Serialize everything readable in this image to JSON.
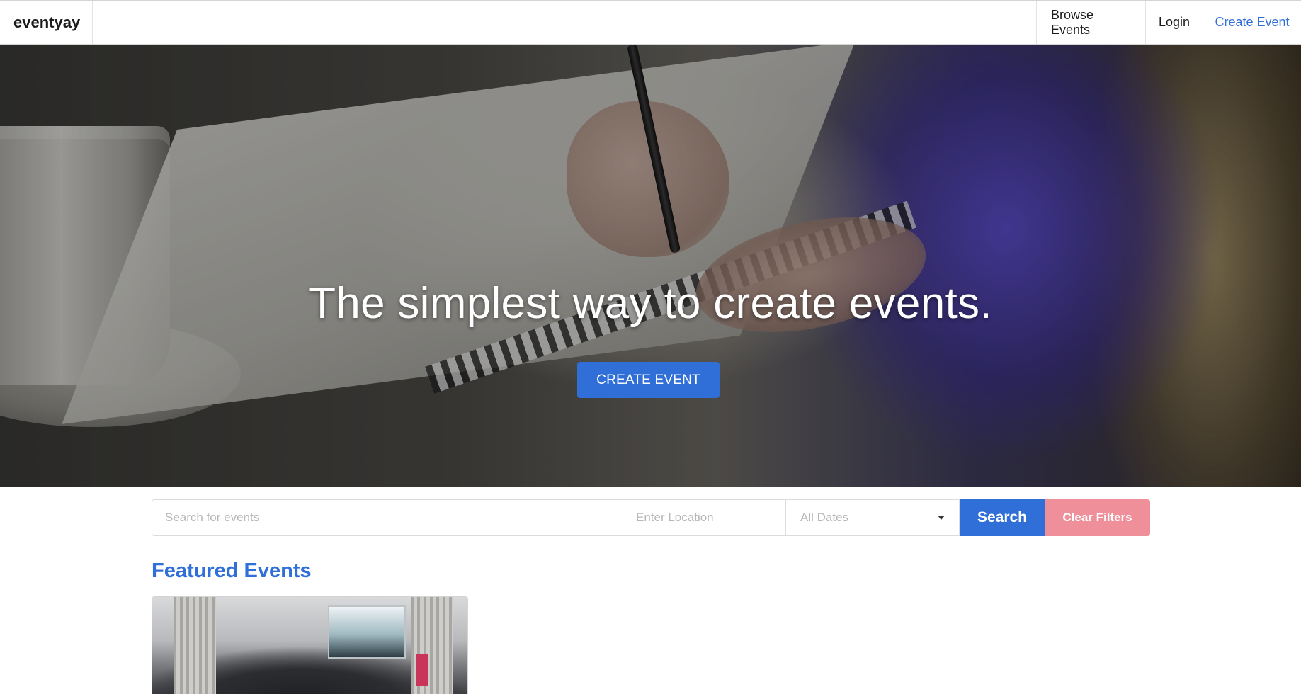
{
  "nav": {
    "brand": "eventyay",
    "items": [
      {
        "label": "Browse Events"
      },
      {
        "label": "Login"
      },
      {
        "label": "Create Event"
      }
    ]
  },
  "hero": {
    "title": "The simplest way to create events.",
    "cta_label": "CREATE EVENT"
  },
  "search": {
    "search_placeholder": "Search for events",
    "location_placeholder": "Enter Location",
    "dates_selected": "All Dates",
    "search_button": "Search",
    "clear_button": "Clear Filters"
  },
  "featured": {
    "heading": "Featured Events"
  },
  "colors": {
    "accent": "#2f6fd7",
    "clear": "#ef8f99"
  }
}
